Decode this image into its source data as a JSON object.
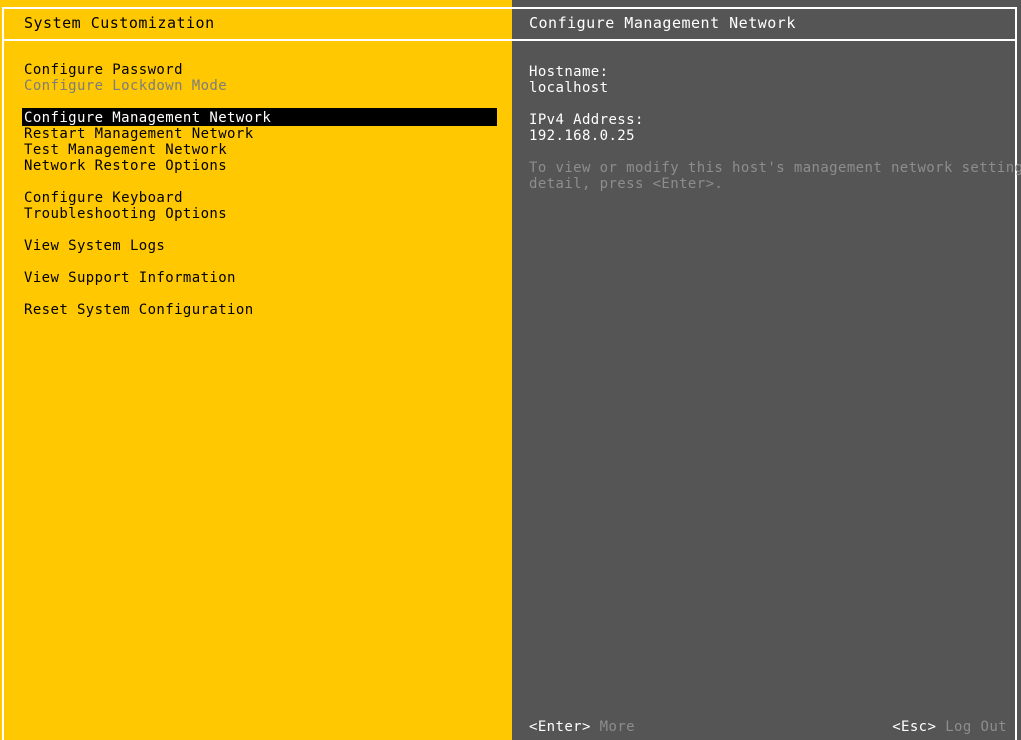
{
  "colors": {
    "left_panel_bg": "#ffc801",
    "right_panel_bg": "#555555",
    "frame": "#ffffff",
    "selected_bg": "#000000",
    "selected_fg": "#ffffff",
    "disabled_fg": "#7d7d7d",
    "hint_fg": "#8d8d8d",
    "text_on_yellow": "#000000",
    "text_on_gray": "#ffffff"
  },
  "left_panel": {
    "title": "System Customization",
    "menu": [
      {
        "label": "Configure Password",
        "state": "normal"
      },
      {
        "label": "Configure Lockdown Mode",
        "state": "disabled"
      },
      {
        "label": "",
        "state": "gap"
      },
      {
        "label": "Configure Management Network",
        "state": "selected"
      },
      {
        "label": "Restart Management Network",
        "state": "normal"
      },
      {
        "label": "Test Management Network",
        "state": "normal"
      },
      {
        "label": "Network Restore Options",
        "state": "normal"
      },
      {
        "label": "",
        "state": "gap"
      },
      {
        "label": "Configure Keyboard",
        "state": "normal"
      },
      {
        "label": "Troubleshooting Options",
        "state": "normal"
      },
      {
        "label": "",
        "state": "gap"
      },
      {
        "label": "View System Logs",
        "state": "normal"
      },
      {
        "label": "",
        "state": "gap"
      },
      {
        "label": "View Support Information",
        "state": "normal"
      },
      {
        "label": "",
        "state": "gap"
      },
      {
        "label": "Reset System Configuration",
        "state": "normal"
      }
    ]
  },
  "right_panel": {
    "title": "Configure Management Network",
    "fields": [
      {
        "label": "Hostname:",
        "value": "localhost"
      },
      {
        "label": "IPv4 Address:",
        "value": "192.168.0.25"
      }
    ],
    "hint_lines": [
      "To view or modify this host's management network settings in",
      "detail, press <Enter>."
    ]
  },
  "statusbar": {
    "left": {
      "key": "<Enter>",
      "desc": "More"
    },
    "right": {
      "key": "<Esc>",
      "desc": "Log Out"
    }
  }
}
